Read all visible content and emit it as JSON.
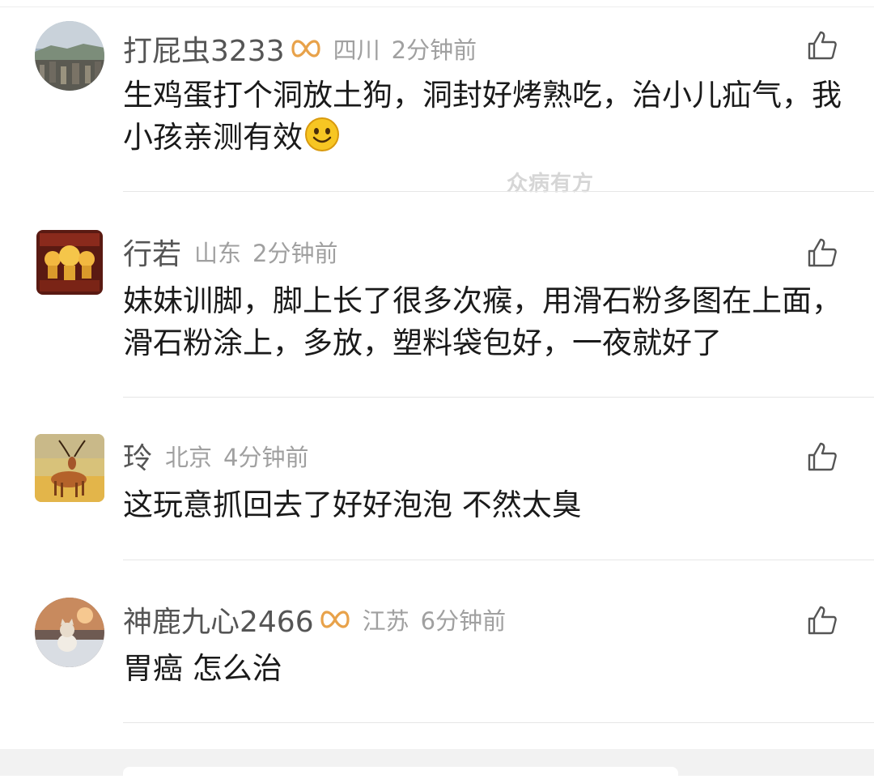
{
  "comments": [
    {
      "username": "打屁虫3233",
      "has_badge": true,
      "location": "四川",
      "time": "2分钟前",
      "text": "生鸡蛋打个洞放土狗，洞封好烤熟吃，治小儿疝气，我小孩亲测有效",
      "emoji": "smile-emoji",
      "avatar": "city-skyline-avatar"
    },
    {
      "username": "行若",
      "has_badge": false,
      "location": "山东",
      "time": "2分钟前",
      "text": "妹妹训脚，脚上长了很多次瘊，用滑石粉多图在上面，滑石粉涂上，多放，塑料袋包好，一夜就好了",
      "avatar": "buddha-shrine-avatar"
    },
    {
      "username": "玲",
      "has_badge": false,
      "location": "北京",
      "time": "4分钟前",
      "text": "这玩意抓回去了好好泡泡 不然太臭",
      "avatar": "antelope-avatar"
    },
    {
      "username": "神鹿九心2466",
      "has_badge": true,
      "location": "江苏",
      "time": "6分钟前",
      "text": "胃癌 怎么治",
      "avatar": "cat-snow-avatar"
    }
  ],
  "watermark": "众病有方",
  "icons": {
    "like": "thumbs-up-icon",
    "badge": "infinity-badge-icon"
  },
  "colors": {
    "username": "#555555",
    "meta": "#a0a0a0",
    "text": "#1a1a1a",
    "badge": "#e8a24a"
  }
}
